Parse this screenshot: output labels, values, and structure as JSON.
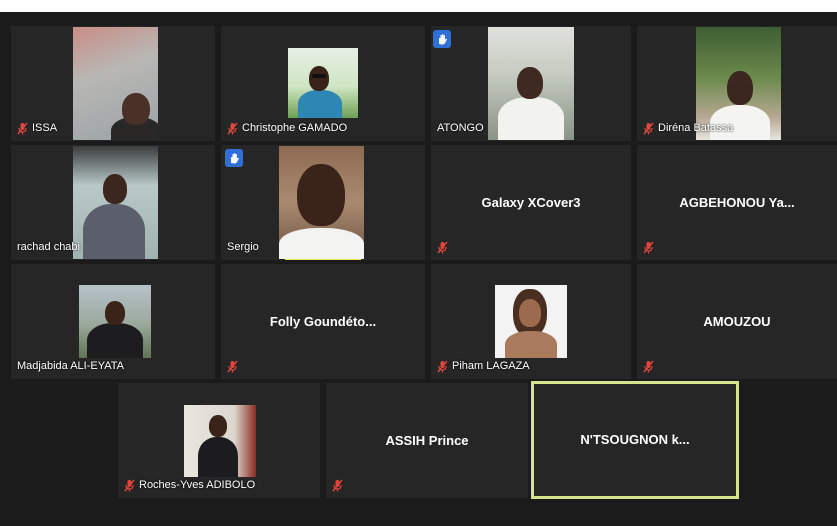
{
  "participants": [
    {
      "name": "ISSA",
      "muted": true
    },
    {
      "name": "Christophe GAMADO",
      "muted": true
    },
    {
      "name": "ATONGO",
      "muted": false,
      "hand_raised": true
    },
    {
      "name": "Diréna Batassa",
      "muted": true
    },
    {
      "name": "rachad chabi",
      "muted": false
    },
    {
      "name": "Sergio",
      "muted": false,
      "hand_raised": true
    },
    {
      "name": "Galaxy XCover3",
      "muted": true
    },
    {
      "name": "AGBEHONOU  Ya...",
      "muted": true
    },
    {
      "name": "Madjabida ALI-EYATA",
      "muted": false
    },
    {
      "name": "Folly  Goundéto...",
      "muted": true
    },
    {
      "name": "Piham LAGAZA",
      "muted": true
    },
    {
      "name": "AMOUZOU",
      "muted": true
    },
    {
      "name": "Roches-Yves ADIBOLO",
      "muted": true
    },
    {
      "name": "ASSIH Prince",
      "muted": true
    },
    {
      "name": "N'TSOUGNON  k...",
      "muted": false,
      "active_speaker": true
    }
  ],
  "colors": {
    "background": "#1b1b1b",
    "tile": "#262626",
    "muted_icon": "#e0463c",
    "hand_badge": "#2f6fd6",
    "active_speaker_border": "#d2e58a"
  },
  "icons": {
    "muted": "mic-off-icon",
    "hand": "raised-hand-icon"
  }
}
